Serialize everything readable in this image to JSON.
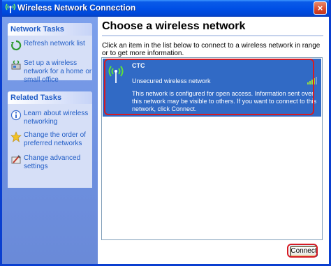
{
  "window": {
    "title": "Wireless Network Connection",
    "close_label": "×"
  },
  "sidebar": {
    "network_tasks": {
      "header": "Network Tasks",
      "items": [
        {
          "label": "Refresh network list",
          "icon": "refresh-icon"
        },
        {
          "label": "Set up a wireless network for a home or small office",
          "icon": "setup-network-icon"
        }
      ]
    },
    "related_tasks": {
      "header": "Related Tasks",
      "items": [
        {
          "label": "Learn about wireless networking",
          "icon": "info-icon"
        },
        {
          "label": "Change the order of preferred networks",
          "icon": "star-icon"
        },
        {
          "label": "Change advanced settings",
          "icon": "settings-icon"
        }
      ]
    }
  },
  "main": {
    "title": "Choose a wireless network",
    "instructions": "Click an item in the list below to connect to a wireless network in range or to get more information.",
    "networks": [
      {
        "ssid": "CTC",
        "status": "Unsecured wireless network",
        "description": "This network is configured for open access. Information sent over this network may be visible to others. If you want to connect to this network, click Connect.",
        "signal_bars": 4,
        "signal_max": 5
      }
    ],
    "connect_label": "Connect"
  },
  "colors": {
    "accent": "#316ac5",
    "highlight": "#d51b24",
    "title_bar": "#0050e6"
  }
}
